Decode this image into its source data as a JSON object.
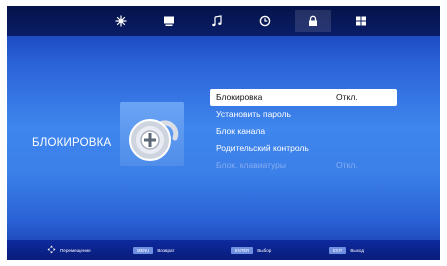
{
  "tabs": [
    {
      "icon": "picture-icon",
      "active": false
    },
    {
      "icon": "monitor-icon",
      "active": false
    },
    {
      "icon": "music-note-icon",
      "active": false
    },
    {
      "icon": "clock-icon",
      "active": false
    },
    {
      "icon": "lock-icon",
      "active": true
    },
    {
      "icon": "grid-icon",
      "active": false
    }
  ],
  "section": {
    "title": "БЛОКИРОВКА",
    "icon": "padlock-icon"
  },
  "menu": {
    "items": [
      {
        "label": "Блокировка",
        "value": "Откл.",
        "state": "selected"
      },
      {
        "label": "Установить пароль",
        "value": "",
        "state": "normal"
      },
      {
        "label": "Блок канала",
        "value": "",
        "state": "normal"
      },
      {
        "label": "Родительский контроль",
        "value": "",
        "state": "normal"
      },
      {
        "label": "Блок. клавиатуры",
        "value": "Откл.",
        "state": "disabled"
      }
    ]
  },
  "footer": {
    "move": {
      "label": "Перемещение",
      "icon": "dpad-icon"
    },
    "back": {
      "key": "MENU",
      "label": "Возврат"
    },
    "select": {
      "key": "ENTER",
      "label": "Выбор"
    },
    "exit": {
      "key": "EXIT",
      "label": "Выход"
    }
  },
  "colors": {
    "accent": "#3f86ee",
    "topbar": "#0a1d66",
    "selected_bg": "#ffffff"
  }
}
